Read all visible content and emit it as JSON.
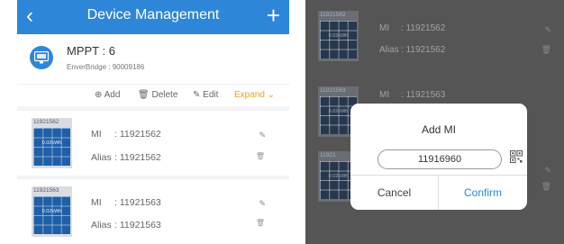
{
  "left_screen": {
    "header": {
      "back_icon": "‹",
      "title": "Device Management",
      "add_icon": "+"
    },
    "device": {
      "name": "MPPT : 6",
      "bridge": "EnverBridge : 90009186"
    },
    "actions": {
      "add": "⊕ Add",
      "delete": "🗑 Delete",
      "edit": "✎ Edit",
      "expand": "Expand ⌄"
    },
    "items": [
      {
        "panel_id": "11921562",
        "kwh": "0.02kWh",
        "mi_label": "MI",
        "mi_value": ": 11921562",
        "alias_label": "Alias",
        "alias_value": ": 11921562",
        "edit_icon": "✎",
        "trash_icon": "🗑"
      },
      {
        "panel_id": "11921563",
        "kwh": "0.02kWh",
        "mi_label": "MI",
        "mi_value": ": 11921563",
        "alias_label": "Alias",
        "alias_value": ": 11921563",
        "edit_icon": "✎",
        "trash_icon": "🗑"
      }
    ]
  },
  "right_screen": {
    "items": [
      {
        "panel_id": "11921562",
        "kwh": "0.02kWh",
        "mi_label": "MI",
        "mi_value": ": 11921562",
        "alias_label": "Alias",
        "alias_value": ": 11921562",
        "edit_icon": "✎",
        "trash_icon": "🗑"
      },
      {
        "panel_id": "11921563",
        "kwh": "0.02kWh",
        "mi_label": "MI",
        "mi_value": ": 11921563",
        "alias_label": "",
        "alias_value": "",
        "edit_icon": "",
        "trash_icon": ""
      },
      {
        "panel_id": "11921",
        "kwh": "0.02kWh",
        "mi_label": "",
        "mi_value": "",
        "alias_label": "",
        "alias_value": "",
        "edit_icon": "✎",
        "trash_icon": "🗑"
      }
    ],
    "dialog": {
      "title": "Add MI",
      "input_value": "11916960",
      "cancel": "Cancel",
      "confirm": "Confirm"
    }
  },
  "colors": {
    "accent": "#2e86d9",
    "expand": "#f0a020",
    "panel_blue": "#1f5fa8"
  }
}
